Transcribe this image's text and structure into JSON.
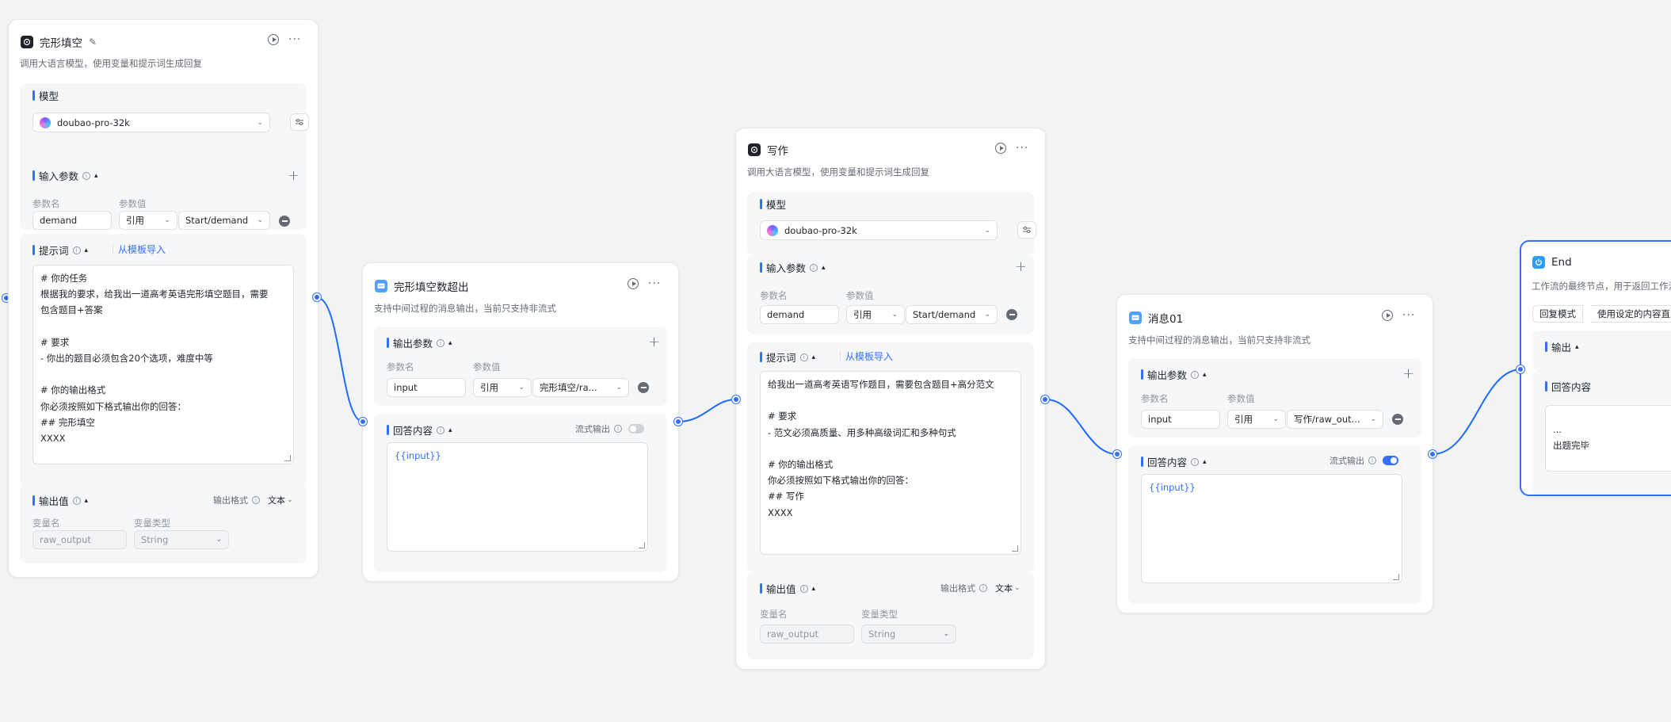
{
  "nodes": {
    "cloze": {
      "title": "完形填空",
      "desc": "调用大语言模型，使用变量和提示词生成回复",
      "model_section": "模型",
      "model_name": "doubao-pro-32k",
      "input_section": "输入参数",
      "param_name_label": "参数名",
      "param_value_label": "参数值",
      "param_name": "demand",
      "ref_label": "引用",
      "ref_value": "Start/demand",
      "prompt_section": "提示词",
      "template_link": "从模板导入",
      "prompt_lines": [
        "# 你的任务",
        "根据我的要求，给我出一道高考英语完形填空题目，需要",
        "包含题目+答案",
        "",
        "# 要求",
        "- 你出的题目必须包含20个选项，难度中等",
        "",
        "# 你的输出格式",
        "你必须按照如下格式输出你的回答：",
        "## 完形填空",
        "XXXX"
      ],
      "output_section": "输出值",
      "output_format_label": "输出格式",
      "output_format_value": "文本",
      "var_name_label": "变量名",
      "var_type_label": "变量类型",
      "var_name": "raw_output",
      "var_type": "String"
    },
    "cloze_msg": {
      "title": "完形填空数超出",
      "desc": "支持中间过程的消息输出，当前只支持非流式",
      "output_params_section": "输出参数",
      "param_name_label": "参数名",
      "param_value_label": "参数值",
      "param_name": "input",
      "ref_label": "引用",
      "ref_value": "完形填空/ra...",
      "answer_section": "回答内容",
      "stream_label": "流式输出",
      "stream_on": false,
      "answer_text": "{{input}}"
    },
    "writing": {
      "title": "写作",
      "desc": "调用大语言模型，使用变量和提示词生成回复",
      "model_section": "模型",
      "model_name": "doubao-pro-32k",
      "input_section": "输入参数",
      "param_name_label": "参数名",
      "param_value_label": "参数值",
      "param_name": "demand",
      "ref_label": "引用",
      "ref_value": "Start/demand",
      "prompt_section": "提示词",
      "template_link": "从模板导入",
      "prompt_lines": [
        "给我出一道高考英语写作题目，需要包含题目+高分范文",
        "",
        "# 要求",
        "- 范文必须高质量、用多种高级词汇和多种句式",
        "",
        "# 你的输出格式",
        "你必须按照如下格式输出你的回答：",
        "## 写作",
        "XXXX"
      ],
      "output_section": "输出值",
      "output_format_label": "输出格式",
      "output_format_value": "文本",
      "var_name_label": "变量名",
      "var_type_label": "变量类型",
      "var_name": "raw_output",
      "var_type": "String"
    },
    "message01": {
      "title": "消息01",
      "desc": "支持中间过程的消息输出，当前只支持非流式",
      "output_params_section": "输出参数",
      "param_name_label": "参数名",
      "param_value_label": "参数值",
      "param_name": "input",
      "ref_label": "引用",
      "ref_value": "写作/raw_out...",
      "answer_section": "回答内容",
      "stream_label": "流式输出",
      "stream_on": true,
      "answer_text": "{{input}}"
    },
    "end": {
      "title": "End",
      "desc": "工作流的最终节点，用于返回工作流",
      "tab_reply": "回复模式",
      "tab_custom": "使用设定的内容直",
      "output_section": "输出",
      "answer_section": "回答内容",
      "answer_lines": [
        "...",
        "出题完毕"
      ]
    }
  },
  "colors": {
    "accent": "#3370ff",
    "canvas": "#f2f3f5",
    "edge": "#1f6bff"
  }
}
